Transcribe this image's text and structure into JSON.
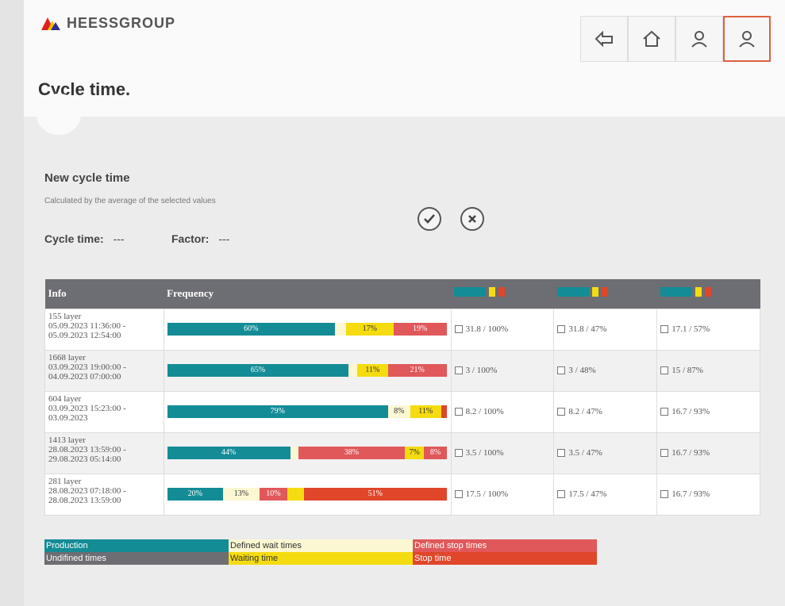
{
  "brand": {
    "name": "HEESSGROUP"
  },
  "page": {
    "title": "Cycle time."
  },
  "nav": [
    {
      "name": "back-icon",
      "label": "back"
    },
    {
      "name": "home-icon",
      "label": "home"
    },
    {
      "name": "user-icon",
      "label": "user"
    },
    {
      "name": "account-icon",
      "label": "account"
    }
  ],
  "new_cycle": {
    "title": "New cycle time",
    "subtitle": "Calculated by the average of the selected values",
    "cycle_label": "Cycle time:",
    "cycle_value": "---",
    "factor_label": "Factor:",
    "factor_value": "---"
  },
  "table": {
    "headers": [
      "Info",
      "Frequency"
    ],
    "rows": [
      {
        "layers": "155 layer",
        "start": "05.09.2023 11:36:00 -",
        "end": "05.09.2023 12:54:00",
        "freq": [
          {
            "type": "production",
            "pct": 60,
            "label": "60%"
          },
          {
            "type": "defined_wait",
            "pct": 4,
            "label": ""
          },
          {
            "type": "waiting",
            "pct": 17,
            "label": "17%"
          },
          {
            "type": "defined_stop",
            "pct": 19,
            "label": "19%"
          }
        ],
        "v1": "31.8 / 100%",
        "v2": "31.8 / 47%",
        "v3": "17.1 / 57%"
      },
      {
        "layers": "1668 layer",
        "start": "03.09.2023 19:00:00 -",
        "end": "04.09.2023 07:00:00",
        "freq": [
          {
            "type": "production",
            "pct": 65,
            "label": "65%"
          },
          {
            "type": "defined_wait",
            "pct": 3,
            "label": ""
          },
          {
            "type": "waiting",
            "pct": 11,
            "label": "11%"
          },
          {
            "type": "defined_stop",
            "pct": 21,
            "label": "21%"
          }
        ],
        "v1": "3 / 100%",
        "v2": "3 / 48%",
        "v3": "15 / 87%"
      },
      {
        "layers": "604 layer",
        "start": "03.09.2023 15:23:00 -",
        "end": "03.09.2023",
        "freq": [
          {
            "type": "production",
            "pct": 79,
            "label": "79%"
          },
          {
            "type": "defined_wait",
            "pct": 8,
            "label": "8%"
          },
          {
            "type": "waiting",
            "pct": 11,
            "label": "11%"
          },
          {
            "type": "stop",
            "pct": 2,
            "label": ""
          }
        ],
        "v1": "8.2 / 100%",
        "v2": "8.2 / 47%",
        "v3": "16.7 / 93%"
      },
      {
        "layers": "1413 layer",
        "start": "28.08.2023 13:59:00 -",
        "end": "29.08.2023 05:14:00",
        "freq": [
          {
            "type": "production",
            "pct": 44,
            "label": "44%"
          },
          {
            "type": "defined_wait",
            "pct": 3,
            "label": ""
          },
          {
            "type": "defined_stop",
            "pct": 38,
            "label": "38%"
          },
          {
            "type": "waiting",
            "pct": 7,
            "label": "7%"
          },
          {
            "type": "defined_stop",
            "pct": 8,
            "label": "8%"
          }
        ],
        "v1": "3.5 / 100%",
        "v2": "3.5 / 47%",
        "v3": "16.7 / 93%"
      },
      {
        "layers": "281 layer",
        "start": "28.08.2023 07:18:00 -",
        "end": "28.08.2023 13:59:00",
        "freq": [
          {
            "type": "production",
            "pct": 20,
            "label": "20%"
          },
          {
            "type": "defined_wait",
            "pct": 13,
            "label": "13%"
          },
          {
            "type": "defined_stop",
            "pct": 10,
            "label": "10%"
          },
          {
            "type": "waiting",
            "pct": 6,
            "label": ""
          },
          {
            "type": "stop",
            "pct": 51,
            "label": "51%"
          }
        ],
        "v1": "17.5 / 100%",
        "v2": "17.5 / 47%",
        "v3": "16.7 / 93%"
      }
    ]
  },
  "legend": [
    {
      "label": "Production",
      "color": "#138c96",
      "text_color": "#ffffff"
    },
    {
      "label": "Defined wait times",
      "color": "#fbf7d2",
      "text_color": "#333333"
    },
    {
      "label": "Defined stop times",
      "color": "#e0585a",
      "text_color": "#ffffff"
    },
    {
      "label": "Undifined times",
      "color": "#6d6d74",
      "text_color": "#ffffff"
    },
    {
      "label": "Waiting time",
      "color": "#f5dc10",
      "text_color": "#333333"
    },
    {
      "label": "Stop time",
      "color": "#e0462a",
      "text_color": "#ffffff"
    }
  ],
  "colors": {
    "production": "#138c96",
    "defined_wait": "#fbf7d2",
    "waiting": "#f5dc10",
    "defined_stop": "#e0585a",
    "stop": "#e0462a",
    "undefined": "#6d6d74",
    "accent": "#e06040"
  }
}
